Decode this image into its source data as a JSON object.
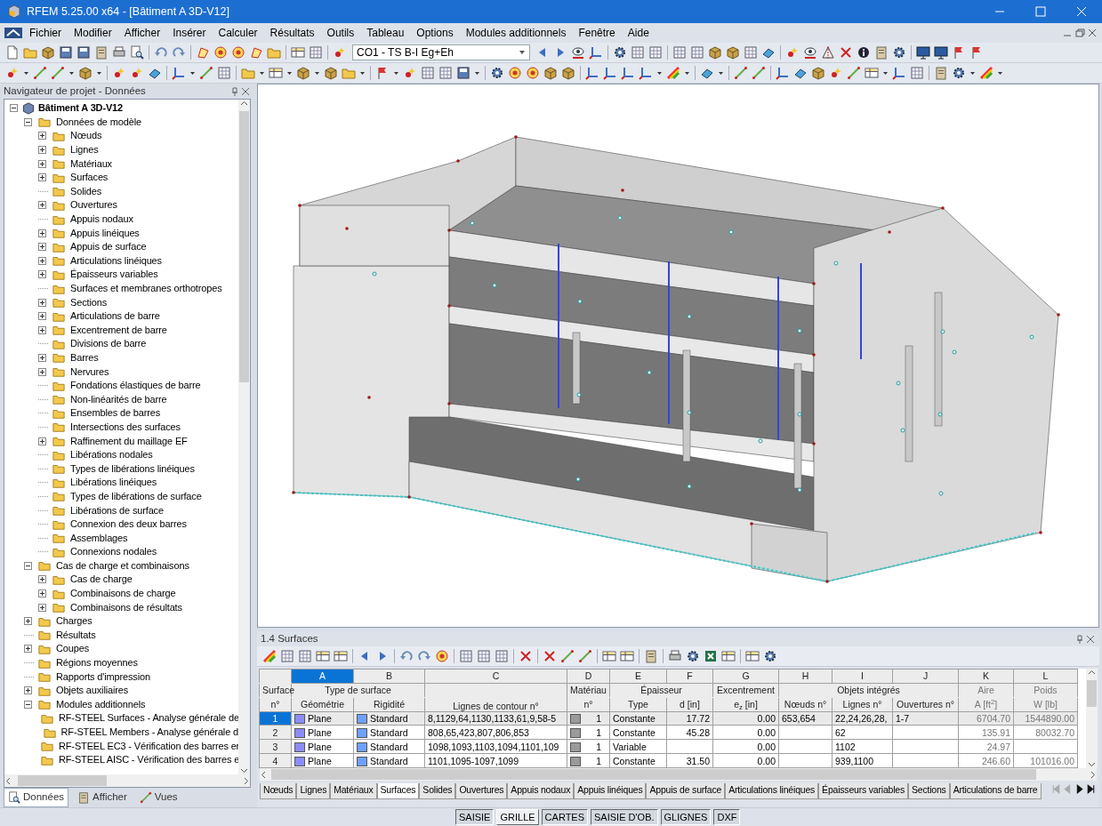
{
  "window": {
    "title": "RFEM 5.25.00 x64 - [Bâtiment A 3D-V12]"
  },
  "menu": [
    "Fichier",
    "Modifier",
    "Afficher",
    "Insérer",
    "Calculer",
    "Résultats",
    "Outils",
    "Tableau",
    "Options",
    "Modules additionnels",
    "Fenêtre",
    "Aide"
  ],
  "toolbar": {
    "load_case_select": {
      "value": "CO1 - TS B-I Eg+Eh"
    }
  },
  "navigator": {
    "title": "Navigateur de projet - Données",
    "tree": [
      {
        "label": "Bâtiment A 3D-V12",
        "expanded": true,
        "children": [
          {
            "label": "Données de modèle",
            "expanded": true,
            "children": [
              {
                "label": "Nœuds",
                "expanded": false
              },
              {
                "label": "Lignes",
                "expanded": false
              },
              {
                "label": "Matériaux",
                "expanded": false
              },
              {
                "label": "Surfaces",
                "expanded": false
              },
              {
                "label": "Solides"
              },
              {
                "label": "Ouvertures",
                "expanded": false
              },
              {
                "label": "Appuis nodaux"
              },
              {
                "label": "Appuis linéiques",
                "expanded": false
              },
              {
                "label": "Appuis de surface",
                "expanded": false
              },
              {
                "label": "Articulations linéiques",
                "expanded": false
              },
              {
                "label": "Épaisseurs variables",
                "expanded": false
              },
              {
                "label": "Surfaces et membranes orthotropes"
              },
              {
                "label": "Sections",
                "expanded": false
              },
              {
                "label": "Articulations de barre",
                "expanded": false
              },
              {
                "label": "Excentrement de barre",
                "expanded": false
              },
              {
                "label": "Divisions de barre"
              },
              {
                "label": "Barres",
                "expanded": false
              },
              {
                "label": "Nervures",
                "expanded": false
              },
              {
                "label": "Fondations élastiques de barre"
              },
              {
                "label": "Non-linéarités de barre"
              },
              {
                "label": "Ensembles de barres"
              },
              {
                "label": "Intersections des surfaces"
              },
              {
                "label": "Raffinement du maillage EF",
                "expanded": false
              },
              {
                "label": "Libérations nodales"
              },
              {
                "label": "Types de libérations linéiques"
              },
              {
                "label": "Libérations linéiques"
              },
              {
                "label": "Types de libérations de surface"
              },
              {
                "label": "Libérations de surface"
              },
              {
                "label": "Connexion des deux barres"
              },
              {
                "label": "Assemblages"
              },
              {
                "label": "Connexions nodales"
              }
            ]
          },
          {
            "label": "Cas de charge et combinaisons",
            "expanded": true,
            "children": [
              {
                "label": "Cas de charge",
                "expanded": false
              },
              {
                "label": "Combinaisons de charge",
                "expanded": false
              },
              {
                "label": "Combinaisons de résultats",
                "expanded": false
              }
            ]
          },
          {
            "label": "Charges",
            "expanded": false
          },
          {
            "label": "Résultats"
          },
          {
            "label": "Coupes",
            "expanded": false
          },
          {
            "label": "Régions moyennes"
          },
          {
            "label": "Rapports d'impression"
          },
          {
            "label": "Objets auxiliaires",
            "expanded": false
          },
          {
            "label": "Modules additionnels",
            "expanded": true,
            "children": [
              {
                "label": "RF-STEEL Surfaces - Analyse générale de"
              },
              {
                "label": "RF-STEEL Members - Analyse générale d"
              },
              {
                "label": "RF-STEEL EC3 - Vérification des barres er"
              },
              {
                "label": "RF-STEEL AISC - Vérification des barres e"
              }
            ]
          }
        ]
      }
    ],
    "tabs": [
      {
        "label": "Données",
        "selected": true
      },
      {
        "label": "Afficher",
        "selected": false
      },
      {
        "label": "Vues",
        "selected": false
      }
    ]
  },
  "table": {
    "title": "1.4 Surfaces",
    "row_header": {
      "title": "Surface",
      "subtitle": "n°"
    },
    "column_groups": [
      {
        "label": "Type de surface",
        "columns": [
          {
            "letter": "A",
            "label": "Géométrie",
            "kind": "swatch",
            "color": "#8c8cff",
            "selected": true
          },
          {
            "letter": "B",
            "label": "Rigidité",
            "kind": "swatch",
            "color": "#6fa0ff",
            "selected": false
          }
        ]
      },
      {
        "columns": [
          {
            "letter": "C",
            "label": "Lignes de contour n°",
            "kind": "text",
            "selected": false
          }
        ]
      },
      {
        "label": "Matériau",
        "columns": [
          {
            "letter": "D",
            "label": "n°",
            "kind": "swatch",
            "color": "#9a9a9a",
            "selected": false
          }
        ]
      },
      {
        "label": "Épaisseur",
        "columns": [
          {
            "letter": "E",
            "label": "Type",
            "kind": "text",
            "selected": false
          },
          {
            "letter": "F",
            "label": "d [in]",
            "kind": "number",
            "selected": false
          }
        ]
      },
      {
        "label": "Excentrement",
        "columns": [
          {
            "letter": "G",
            "label": "e$_{z}$ [in]",
            "kind": "number",
            "selected": false
          }
        ]
      },
      {
        "label": "Objets intégrés",
        "columns": [
          {
            "letter": "H",
            "label": "Nœuds n°",
            "kind": "text",
            "selected": false
          },
          {
            "letter": "I",
            "label": "Lignes n°",
            "kind": "text",
            "selected": false
          },
          {
            "letter": "J",
            "label": "Ouvertures n°",
            "kind": "text",
            "selected": false
          }
        ]
      },
      {
        "label": "Aire",
        "columns": [
          {
            "letter": "K",
            "label": "A [ft$^{2}$]",
            "kind": "computed",
            "selected": false
          }
        ]
      },
      {
        "label": "Poids",
        "columns": [
          {
            "letter": "L",
            "label": "W [lb]",
            "kind": "computed",
            "selected": false
          }
        ]
      }
    ],
    "rows": [
      {
        "number": "1",
        "selected": true,
        "cells": {
          "A": "Plane",
          "B": "Standard",
          "C": "8,1129,64,1130,1133,61,9,58-5",
          "D": "1",
          "E": "Constante",
          "F": "17.72",
          "G": "0.00",
          "H": "653,654",
          "I": "22,24,26,28,",
          "J": "1-7",
          "K": "6704.70",
          "L": "1544890.00"
        }
      },
      {
        "number": "2",
        "selected": false,
        "cells": {
          "A": "Plane",
          "B": "Standard",
          "C": "808,65,423,807,806,853",
          "D": "1",
          "E": "Constante",
          "F": "45.28",
          "G": "0.00",
          "I": "62",
          "K": "135.91",
          "L": "80032.70"
        }
      },
      {
        "number": "3",
        "selected": false,
        "cells": {
          "A": "Plane",
          "B": "Standard",
          "C": "1098,1093,1103,1094,1101,109",
          "D": "1",
          "E": "Variable",
          "G": "0.00",
          "I": "1102",
          "K": "24.97"
        }
      },
      {
        "number": "4",
        "selected": false,
        "cells": {
          "A": "Plane",
          "B": "Standard",
          "C": "1101,1095-1097,1099",
          "D": "1",
          "E": "Constante",
          "F": "31.50",
          "G": "0.00",
          "I": "939,1100",
          "K": "246.60",
          "L": "101016.00"
        }
      }
    ],
    "sheet_tabs": [
      {
        "label": "Nœuds",
        "selected": false
      },
      {
        "label": "Lignes",
        "selected": false
      },
      {
        "label": "Matériaux",
        "selected": false
      },
      {
        "label": "Surfaces",
        "selected": true
      },
      {
        "label": "Solides",
        "selected": false
      },
      {
        "label": "Ouvertures",
        "selected": false
      },
      {
        "label": "Appuis nodaux",
        "selected": false
      },
      {
        "label": "Appuis linéiques",
        "selected": false
      },
      {
        "label": "Appuis de surface",
        "selected": false
      },
      {
        "label": "Articulations linéiques",
        "selected": false
      },
      {
        "label": "Épaisseurs variables",
        "selected": false
      },
      {
        "label": "Sections",
        "selected": false
      },
      {
        "label": "Articulations de barre",
        "selected": false
      }
    ]
  },
  "status_bar": [
    {
      "label": "SAISIE",
      "on": false
    },
    {
      "label": "GRILLE",
      "on": true
    },
    {
      "label": "CARTES",
      "on": false
    },
    {
      "label": "SAISIE D'OB.",
      "on": false
    },
    {
      "label": "GLIGNES",
      "on": false
    },
    {
      "label": "DXF",
      "on": false
    }
  ]
}
